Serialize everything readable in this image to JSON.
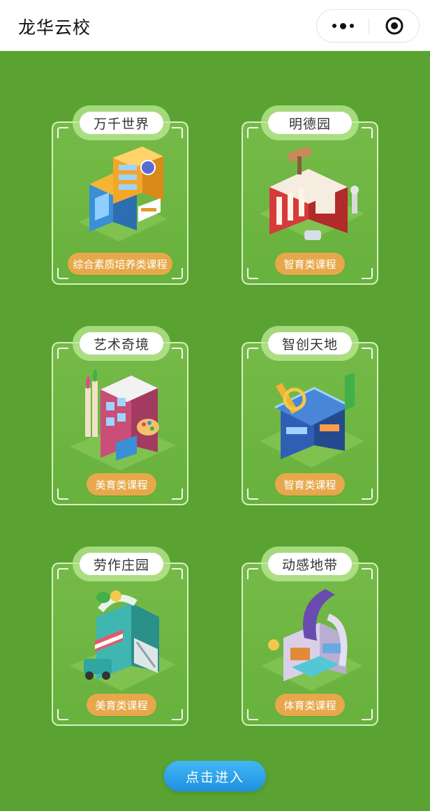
{
  "app": {
    "title": "龙华云校"
  },
  "capsule": {
    "more_icon": "more-dots-icon",
    "close_icon": "target-circle-icon"
  },
  "modules": [
    {
      "title": "万千世界",
      "badge": "综合素质培养类课程",
      "icon": "school-building-illustration"
    },
    {
      "title": "明德园",
      "badge": "智育类课程",
      "icon": "museum-building-illustration"
    },
    {
      "title": "艺术奇境",
      "badge": "美育类课程",
      "icon": "art-studio-illustration"
    },
    {
      "title": "智创天地",
      "badge": "智育类课程",
      "icon": "innovation-lab-illustration"
    },
    {
      "title": "劳作庄园",
      "badge": "美育类课程",
      "icon": "workshop-illustration"
    },
    {
      "title": "动感地带",
      "badge": "体育类课程",
      "icon": "sports-park-illustration"
    }
  ],
  "enter_button": {
    "label": "点击进入"
  },
  "colors": {
    "background": "#5aa332",
    "badge": "#e7a84b",
    "button": "#2a9fe8"
  }
}
